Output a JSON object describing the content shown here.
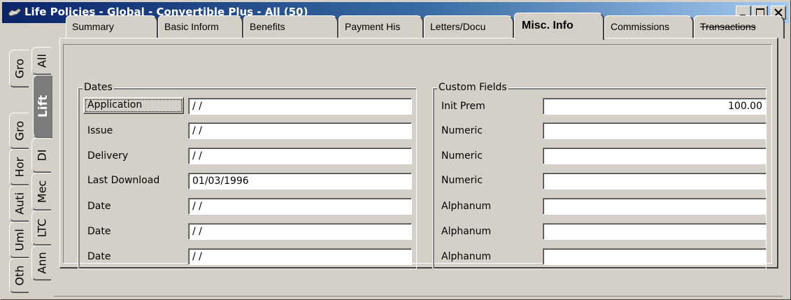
{
  "window": {
    "title": "Life Policies - Global - Convertible Plus - All (50)",
    "icon": "policy-icon"
  },
  "side_tabs": {
    "outer": [
      "Oth",
      "Uml",
      "Auti",
      "Hor",
      "Gro",
      "Gro"
    ],
    "inner": [
      "Ann",
      "LTC",
      "Mec",
      "DI",
      "Lift",
      "All"
    ],
    "active": "Lift"
  },
  "top_tabs": [
    {
      "label": "Summary"
    },
    {
      "label": "Basic Inform"
    },
    {
      "label": "Benefits"
    },
    {
      "label": "Payment His"
    },
    {
      "label": "Letters/Docu"
    },
    {
      "label": "Misc. Info",
      "active": true
    },
    {
      "label": "Commissions"
    },
    {
      "label": "Transactions",
      "strikethrough": true
    }
  ],
  "dates": {
    "title": "Dates",
    "rows": [
      {
        "label": "Application",
        "value": " / /",
        "is_button": true
      },
      {
        "label": "Issue",
        "value": " / /"
      },
      {
        "label": "Delivery",
        "value": " / /"
      },
      {
        "label": "Last Download",
        "value": "01/03/1996"
      },
      {
        "label": "Date",
        "value": " / /"
      },
      {
        "label": "Date",
        "value": " / /"
      },
      {
        "label": "Date",
        "value": " / /"
      }
    ]
  },
  "custom_fields": {
    "title": "Custom Fields",
    "rows": [
      {
        "label": "Init Prem",
        "value": "100.00"
      },
      {
        "label": "Numeric",
        "value": ""
      },
      {
        "label": "Numeric",
        "value": ""
      },
      {
        "label": "Numeric",
        "value": ""
      },
      {
        "label": "Alphanum",
        "value": ""
      },
      {
        "label": "Alphanum",
        "value": ""
      },
      {
        "label": "Alphanum",
        "value": ""
      }
    ]
  },
  "colors": {
    "title_gradient_start": "#0a246a",
    "title_gradient_end": "#a6caf0",
    "face": "#d4d0c8"
  }
}
